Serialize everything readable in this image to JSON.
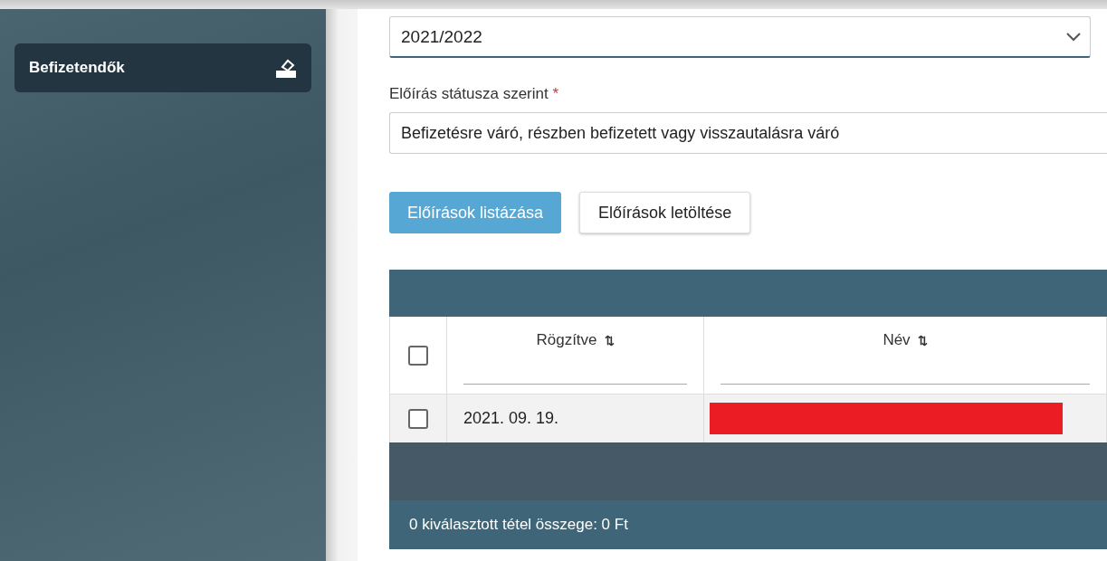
{
  "sidebar": {
    "items": [
      {
        "label": "Befizetendők",
        "selected": true
      }
    ]
  },
  "year_select": {
    "value": "2021/2022"
  },
  "status_filter": {
    "label": "Előírás státusza szerint",
    "required_mark": "*",
    "value": "Befizetésre váró, részben befizetett vagy visszautalásra váró"
  },
  "buttons": [
    {
      "label": "Előírások listázása",
      "kind": "primary"
    },
    {
      "label": "Előírások letöltése",
      "kind": "secondary"
    }
  ],
  "table": {
    "select_all": {
      "checked": false
    },
    "columns": [
      {
        "label": "Rögzítve",
        "sort_icon": "⇅"
      },
      {
        "label": "Név",
        "sort_icon": "⇅"
      }
    ],
    "rows": [
      {
        "checked": false,
        "date": "2021. 09. 19.",
        "name_redacted": true
      }
    ],
    "footer": "0 kiválasztott tétel összege: 0 Ft"
  }
}
